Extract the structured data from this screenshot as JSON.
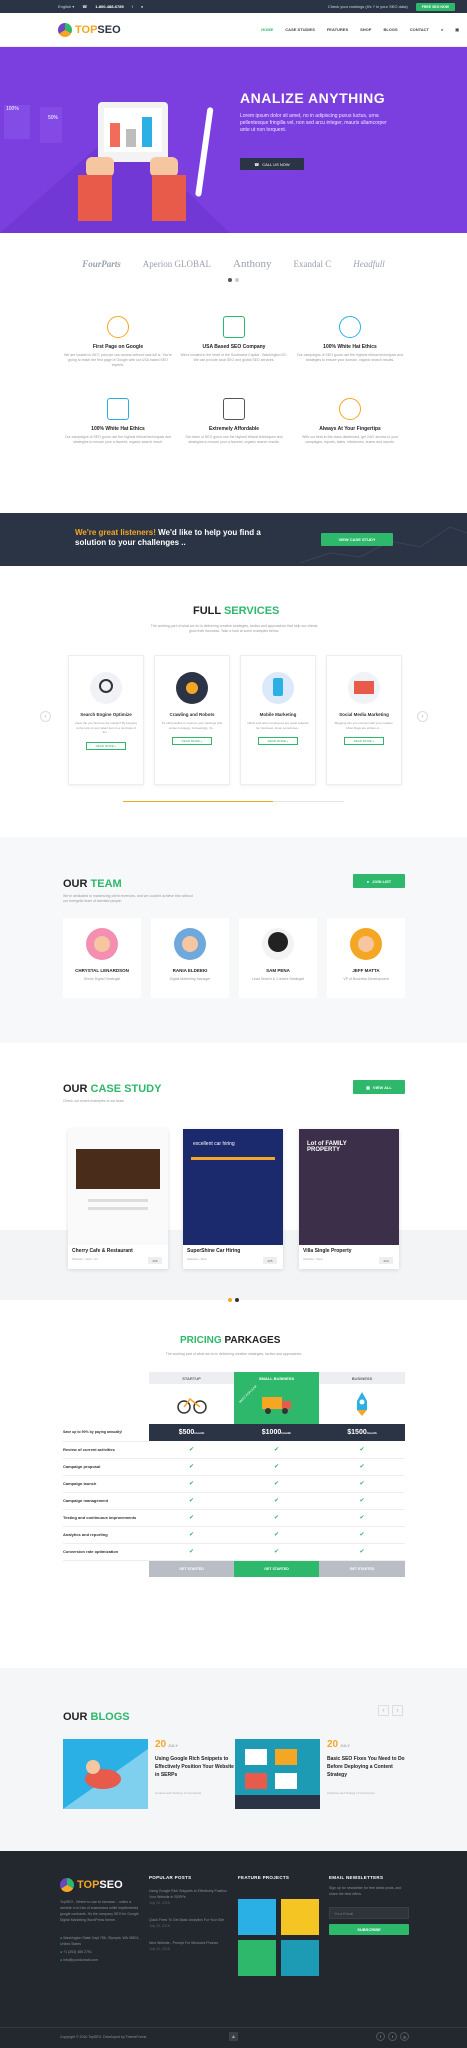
{
  "topbar": {
    "language": "English ▾",
    "phone": "1-800-488-6789",
    "check_text": "Check your rankings (it's ? in your SEO data)",
    "free_seo_label": "FREE SEO NOW"
  },
  "nav": {
    "logo_prefix": "TOP",
    "logo_suffix": "SEO",
    "items": [
      "HOME",
      "CASE STUDIES",
      "FEATURES",
      "SHOP",
      "BLOGS",
      "CONTACT"
    ]
  },
  "hero": {
    "title": "ANALIZE ANYTHING",
    "text": "Lorem ipsum dolor sit amet, no in adipiscing purus luctus, urna pellentesque fringilla vel, non sed arcu integer, mauris ullamcorper ante ut non torquent.",
    "cta_label": "CALL US NOW",
    "chart_pct_1": "100%",
    "chart_pct_2": "50%"
  },
  "clients": [
    "FourParts",
    "Aperion GLOBAL",
    "Anthony",
    "Exandal C",
    "Headfull"
  ],
  "features": [
    {
      "title": "First Page on Google",
      "text": "We are located in 0671 prior,we can access without rank full is. You're going to reach the first page of Google with our USA based SEO experts."
    },
    {
      "title": "USA Based SEO Company",
      "text": "We're located in the heart of the Southwest Capital - Washington DC. We can provide local SEO and global SEO services."
    },
    {
      "title": "100% White Hat Ethics",
      "text": "Our campaigns of SEO gurus use the highest ethical techniques and strategies to ensure your domain, organic search results."
    },
    {
      "title": "100% White Hat Ethics",
      "text": "Our campaigns of SEO gurus use the highest ethical techniques and strategies to ensure your a favored, organic search result."
    },
    {
      "title": "Extremely Affordable",
      "text": "Our team of SEO gurus use the highest ethical techniques and strategies to ensure your a favored, organic search results."
    },
    {
      "title": "Always At Your Fingertips",
      "text": "With our best-in-the-class dashboard, get 24x7 access to your campaigns, reports, tasks, milestones, teams and reports."
    }
  ],
  "cta_band": {
    "highlight": "We're great listeners!",
    "text": " We'd like to help you find a solution to your challenges ..",
    "button_label": "VIEW CASE STUDY"
  },
  "services": {
    "title_a": "FULL",
    "title_b": "SERVICES",
    "subtitle": "The working part of what we do is delivering creative strategies, tactics and approaches that help our clients grow their business. Take a look at some examples below.",
    "read_more": "READ MORE »",
    "items": [
      {
        "title": "Search Engine Optimize",
        "text": "Have the you become the master? By keeping to the look of your talent item is a reminder of the..."
      },
      {
        "title": "Crawling and Robots",
        "text": "It's still possible to improve your rankings with content strategy. Increasingly, it's..."
      },
      {
        "title": "Mobile Marketing",
        "text": "CEOs and other employees are great subjects for interviews. Even sometimes..."
      },
      {
        "title": "Social Media Marketing",
        "text": "Blogging lets you connect with your readers. Most blogs are written or..."
      }
    ]
  },
  "team": {
    "title_a": "OUR",
    "title_b": "TEAM",
    "subtitle": "We're dedicated to maximizing client revenues, and we couldn't achieve this without our energetic team of talented people.",
    "join_label": "JOIN LIST",
    "members": [
      {
        "name": "CHRYSTAL LENARDSON",
        "role": "Senior Digital Strategist"
      },
      {
        "name": "RANIA ELDEEKI",
        "role": "Digital Marketing Manager"
      },
      {
        "name": "SAM PENA",
        "role": "Lead Search & Content Strategist"
      },
      {
        "name": "JEFF MATTA",
        "role": "VP of Business Development"
      }
    ]
  },
  "cases": {
    "title_a": "OUR",
    "title_b": "CASE STUDY",
    "subtitle": "Check out recent examples of our team",
    "view_all_label": "VIEW ALL",
    "items": [
      {
        "title": "Cherry Cafe & Restaurant",
        "meta": "Website • Web • Art",
        "badge": "206"
      },
      {
        "title": "SuperShine Car Hiring",
        "meta": "Website • Web",
        "badge": "205"
      },
      {
        "title": "Villa Single Property",
        "meta": "Website • Web",
        "badge": "204"
      }
    ],
    "shot2_text": "excellent car hiring",
    "shot3_text": "Lot of FAMILY PROPERTY"
  },
  "pricing": {
    "title_a": "PRICING",
    "title_b": "PARKAGES",
    "subtitle": "The working part of what we do is delivering creative strategies, tactics and approaches.",
    "ribbon": "MOST POPULAR",
    "plans": [
      {
        "name": "STARTUP",
        "price": "$500",
        "period": "/month",
        "button": "GET STARTED"
      },
      {
        "name": "SMALL BUSINESS",
        "price": "$1000",
        "period": "/month",
        "button": "GET STARTED"
      },
      {
        "name": "BUSINESS",
        "price": "$1500",
        "period": "/month",
        "button": "GET STARTED"
      }
    ],
    "features": [
      "Save up to 90% by paying annually!",
      "Review of current activities",
      "Campaign proposal",
      "Campaign launch",
      "Campaign management",
      "Testing and continuous improvements",
      "Analytics and reporting",
      "Conversion rate optimization"
    ]
  },
  "blogs": {
    "title_a": "OUR",
    "title_b": "BLOGS",
    "items": [
      {
        "day": "20",
        "month": "JULY",
        "title": "Using Google Rich Snippets to Effectively Position Your Website in SERPs",
        "meta": "Content and Tooling  |  0 Comments"
      },
      {
        "day": "20",
        "month": "JULY",
        "title": "Basic SEO Fixes You Need to Do Before Deploying a Content Strategy",
        "meta": "Analytics and Tooling  |  0 Comments"
      }
    ]
  },
  "footer": {
    "about": "TopSEO - Where to use to increase... online a website in to lots of businesses while implemented google contracts. It's the company SEO for Google Digital Marketing WordPress theme.",
    "address": "Washington State Capt 786, Olympia, WA 98501, United States",
    "phone": "+1 (253) 486 2791",
    "email": "info@yourdomain.com",
    "popular_title": "POPULAR POSTS",
    "popular_posts": [
      {
        "title": "Using Google Rich Snippets to Effectively Position Your Website in SERPs",
        "date": "July 20, 2016"
      },
      {
        "title": "Quick Fixes To Get Basic Analytics For Your Site",
        "date": "July 20, 2016"
      },
      {
        "title": "New Website - Prompt For Windows Phones",
        "date": "July 20, 2016"
      }
    ],
    "featured_title": "FEATURE PROJECTS",
    "newsletter_title": "EMAIL NEWSLETTERS",
    "newsletter_text": "Sign up for newsletter for free latest posts, and share the best offers.",
    "email_placeholder": "Your Email",
    "subscribe_label": "SUBSCRIBE",
    "copyright": "Copyright © 2016 TopSEO. Developed by ThemeForest",
    "socials": [
      "f",
      "t",
      "g"
    ]
  },
  "colors": {
    "green": "#2db86b",
    "purple": "#7b3fe0",
    "navy": "#2b3445",
    "orange": "#f5a623"
  }
}
